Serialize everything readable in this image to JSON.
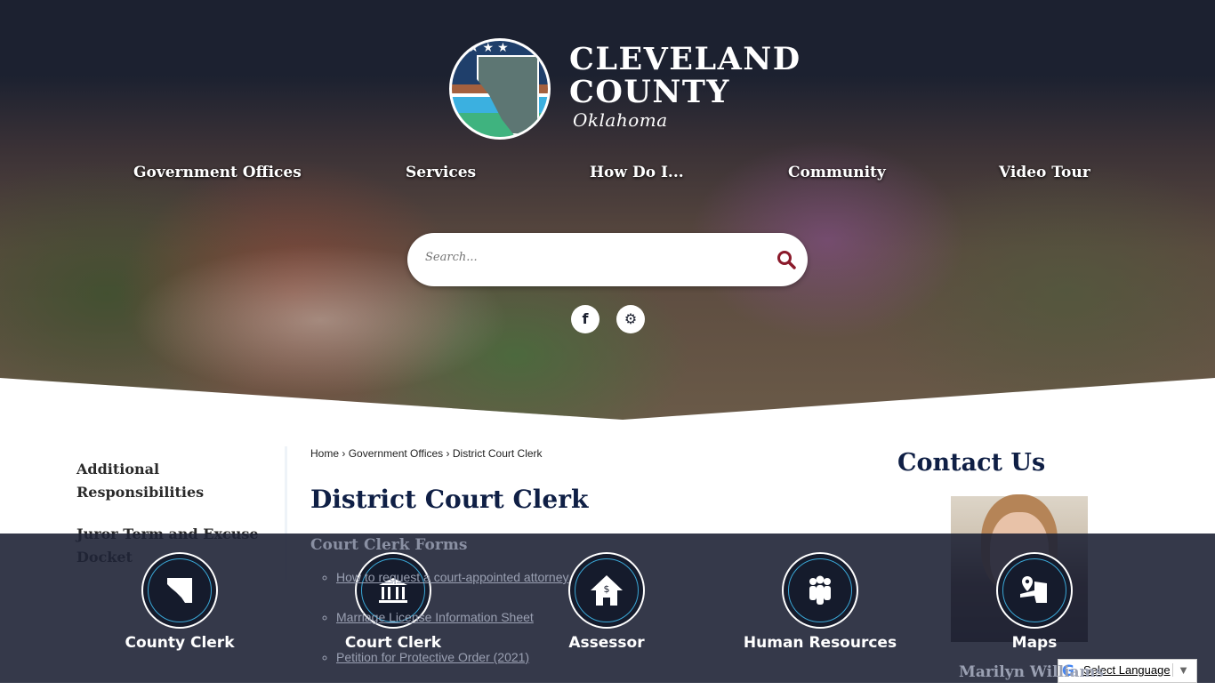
{
  "brand": {
    "line1": "CLEVELAND",
    "line2": "COUNTY",
    "line3": "Oklahoma"
  },
  "nav": [
    "Government Offices",
    "Services",
    "How Do I...",
    "Community",
    "Video Tour"
  ],
  "search": {
    "placeholder": "Search..."
  },
  "social": {
    "facebook": "f"
  },
  "sidebar": [
    "Additional Responsibilities",
    "Juror Term and Excuse Docket"
  ],
  "breadcrumb": {
    "home": "Home",
    "parent": "Government Offices",
    "current": "District Court Clerk"
  },
  "page_title": "District Court Clerk",
  "section_title": "Court Clerk Forms",
  "forms": [
    "How to request a court-appointed attorney",
    "Marriage License Information Sheet",
    "Petition for Protective Order (2021)"
  ],
  "contact": {
    "title": "Contact Us",
    "name": "Marilyn Williams"
  },
  "quick_links": [
    "County Clerk",
    "Court Clerk",
    "Assessor",
    "Human Resources",
    "Maps"
  ],
  "translate": {
    "label": "Select Language",
    "arrow": "▼",
    "g": "G"
  },
  "colors": {
    "navy": "#0f1f45",
    "accent": "#3aa7d6",
    "search_icon": "#8b1a2b"
  }
}
